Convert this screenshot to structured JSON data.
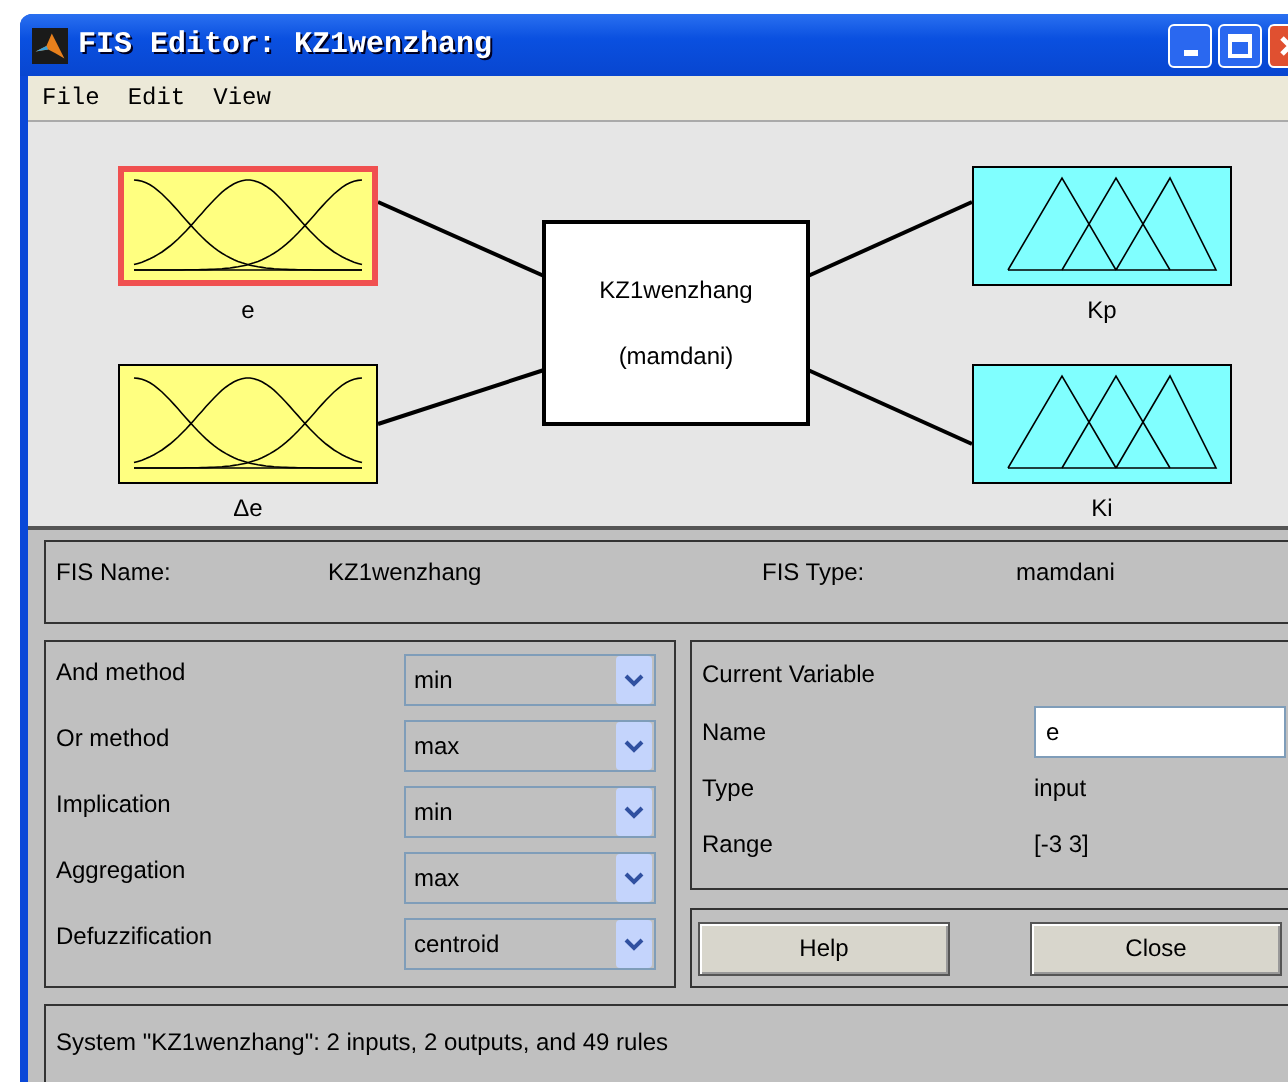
{
  "window": {
    "title": "FIS Editor: KZ1wenzhang"
  },
  "menu": [
    "File",
    "Edit",
    "View"
  ],
  "diagram": {
    "inputs": [
      {
        "name": "e",
        "selected": true,
        "kind": "gaussian"
      },
      {
        "name": "Δe",
        "selected": false,
        "kind": "gaussian"
      }
    ],
    "system": {
      "name": "KZ1wenzhang",
      "type": "(mamdani)"
    },
    "outputs": [
      {
        "name": "Kp",
        "selected": false,
        "kind": "triangle"
      },
      {
        "name": "Ki",
        "selected": false,
        "kind": "triangle"
      }
    ]
  },
  "fis_info": {
    "name_label": "FIS Name:",
    "name": "KZ1wenzhang",
    "type_label": "FIS Type:",
    "type": "mamdani"
  },
  "methods": [
    {
      "label": "And method",
      "value": "min"
    },
    {
      "label": "Or method",
      "value": "max"
    },
    {
      "label": "Implication",
      "value": "min"
    },
    {
      "label": "Aggregation",
      "value": "max"
    },
    {
      "label": "Defuzzification",
      "value": "centroid"
    }
  ],
  "current_variable": {
    "title": "Current Variable",
    "fields": [
      {
        "label": "Name",
        "value": "e",
        "kind": "input"
      },
      {
        "label": "Type",
        "value": "input",
        "kind": "text"
      },
      {
        "label": "Range",
        "value": "[-3 3]",
        "kind": "text"
      }
    ]
  },
  "buttons": [
    "Help",
    "Close"
  ],
  "status": "System \"KZ1wenzhang\": 2 inputs, 2 outputs, and 49 rules"
}
